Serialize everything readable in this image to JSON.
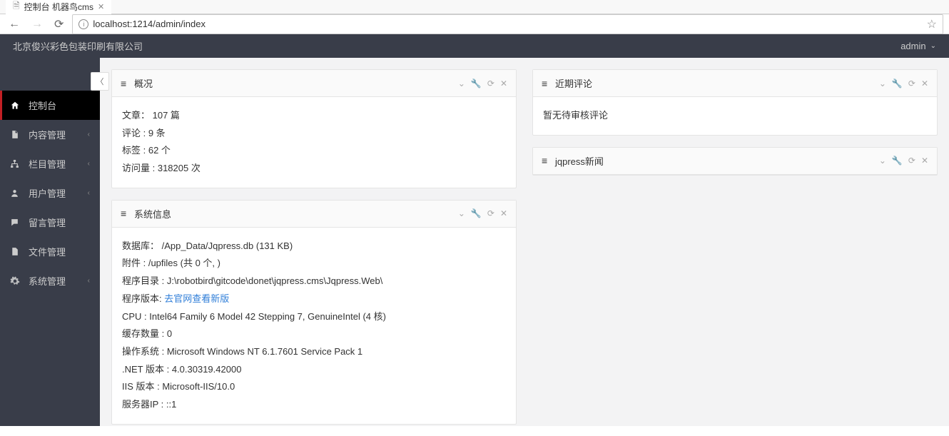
{
  "browser": {
    "tab": {
      "title": "控制台 机器鸟cms",
      "icon": "document-icon"
    },
    "url": "localhost:1214/admin/index"
  },
  "header": {
    "site_name": "北京俊兴彩色包装印刷有限公司",
    "user_label": "admin"
  },
  "sidebar": {
    "items": [
      {
        "label": "控制台",
        "icon": "home-icon",
        "active": true,
        "expandable": false
      },
      {
        "label": "内容管理",
        "icon": "document-icon",
        "active": false,
        "expandable": true
      },
      {
        "label": "栏目管理",
        "icon": "sitemap-icon",
        "active": false,
        "expandable": true
      },
      {
        "label": "用户管理",
        "icon": "user-icon",
        "active": false,
        "expandable": true
      },
      {
        "label": "留言管理",
        "icon": "comment-icon",
        "active": false,
        "expandable": false
      },
      {
        "label": "文件管理",
        "icon": "file-icon",
        "active": false,
        "expandable": false
      },
      {
        "label": "系统管理",
        "icon": "gear-icon",
        "active": false,
        "expandable": true
      }
    ]
  },
  "panels": {
    "overview": {
      "title": "概况",
      "line1": "文章： 107 篇",
      "line2": "评论 : 9 条",
      "line3": "标签 : 62 个",
      "line4": "访问量 : 318205 次"
    },
    "recent_comments": {
      "title": "近期评论",
      "body": "暂无待审核评论"
    },
    "system_info": {
      "title": "系统信息",
      "l1": "数据库： /App_Data/Jqpress.db (131 KB)",
      "l2": "附件 : /upfiles (共 0 个, )",
      "l3": "程序目录 : J:\\robotbird\\gitcode\\donet\\jqpress.cms\\Jqpress.Web\\",
      "l4_prefix": "程序版本: ",
      "l4_link": "去官网查看新版",
      "l5": "CPU : Intel64 Family 6 Model 42 Stepping 7, GenuineIntel (4 核)",
      "l6": "缓存数量 : 0",
      "l7": "操作系统 : Microsoft Windows NT 6.1.7601 Service Pack 1",
      "l8": ".NET 版本 : 4.0.30319.42000",
      "l9": "IIS 版本 : Microsoft-IIS/10.0",
      "l10": "服务器IP : ::1"
    },
    "news": {
      "title": "jqpress新闻"
    }
  }
}
